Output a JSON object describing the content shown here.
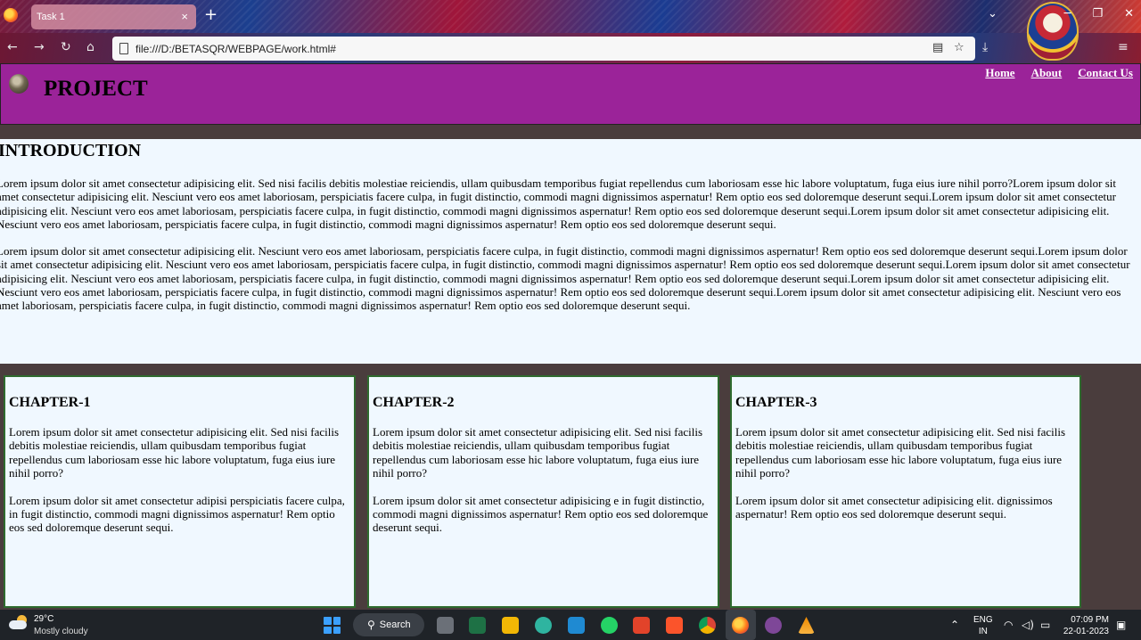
{
  "browser": {
    "tab_title": "Task 1",
    "tab_close": "×",
    "new_tab": "+",
    "url": "file:///D:/BETASQR/WEBPAGE/work.html#",
    "icons": [
      "firefox-icon",
      "back-icon",
      "forward-icon",
      "reload-icon",
      "home-icon",
      "reader-view-icon",
      "bookmark-star-icon",
      "download-icon",
      "menu-icon"
    ]
  },
  "site": {
    "title": "PROJECT",
    "nav": [
      "Home",
      "About",
      "Contact Us"
    ],
    "colors": {
      "header": "#9b2399",
      "content": "#f0f8ff",
      "background": "#4a3d3d",
      "chapter_border": "#2e6b2e"
    }
  },
  "intro": {
    "heading": "INTRODUCTION",
    "p1": "Lorem ipsum dolor sit amet consectetur adipisicing elit. Sed nisi facilis debitis molestiae reiciendis, ullam quibusdam temporibus fugiat repellendus cum laboriosam esse hic labore voluptatum, fuga eius iure nihil porro?Lorem ipsum dolor sit amet consectetur adipisicing elit. Nesciunt vero eos amet laboriosam, perspiciatis facere culpa, in fugit distinctio, commodi magni dignissimos aspernatur! Rem optio eos sed doloremque deserunt sequi.Lorem ipsum dolor sit amet consectetur adipisicing elit. Nesciunt vero eos amet laboriosam, perspiciatis facere culpa, in fugit distinctio, commodi magni dignissimos aspernatur! Rem optio eos sed doloremque deserunt sequi.Lorem ipsum dolor sit amet consectetur adipisicing elit. Nesciunt vero eos amet laboriosam, perspiciatis facere culpa, in fugit distinctio, commodi magni dignissimos aspernatur! Rem optio eos sed doloremque deserunt sequi.",
    "p2": "Lorem ipsum dolor sit amet consectetur adipisicing elit. Nesciunt vero eos amet laboriosam, perspiciatis facere culpa, in fugit distinctio, commodi magni dignissimos aspernatur! Rem optio eos sed doloremque deserunt sequi.Lorem ipsum dolor sit amet consectetur adipisicing elit. Nesciunt vero eos amet laboriosam, perspiciatis facere culpa, in fugit distinctio, commodi magni dignissimos aspernatur! Rem optio eos sed doloremque deserunt sequi.Lorem ipsum dolor sit amet consectetur adipisicing elit. Nesciunt vero eos amet laboriosam, perspiciatis facere culpa, in fugit distinctio, commodi magni dignissimos aspernatur! Rem optio eos sed doloremque deserunt sequi.Lorem ipsum dolor sit amet consectetur adipisicing elit. Nesciunt vero eos amet laboriosam, perspiciatis facere culpa, in fugit distinctio, commodi magni dignissimos aspernatur! Rem optio eos sed doloremque deserunt sequi.Lorem ipsum dolor sit amet consectetur adipisicing elit. Nesciunt vero eos amet laboriosam, perspiciatis facere culpa, in fugit distinctio, commodi magni dignissimos aspernatur! Rem optio eos sed doloremque deserunt sequi."
  },
  "chapters": [
    {
      "heading": "CHAPTER-1",
      "p1": "Lorem ipsum dolor sit amet consectetur adipisicing elit. Sed nisi facilis debitis molestiae reiciendis, ullam quibusdam temporibus fugiat repellendus cum laboriosam esse hic labore voluptatum, fuga eius iure nihil porro?",
      "p2": "Lorem ipsum dolor sit amet consectetur adipisi perspiciatis facere culpa, in fugit distinctio, commodi magni dignissimos aspernatur! Rem optio eos sed doloremque deserunt sequi."
    },
    {
      "heading": "CHAPTER-2",
      "p1": "Lorem ipsum dolor sit amet consectetur adipisicing elit. Sed nisi facilis debitis molestiae reiciendis, ullam quibusdam temporibus fugiat repellendus cum laboriosam esse hic labore voluptatum, fuga eius iure nihil porro?",
      "p2": "Lorem ipsum dolor sit amet consectetur adipisicing e in fugit distinctio, commodi magni dignissimos aspernatur! Rem optio eos sed doloremque deserunt sequi."
    },
    {
      "heading": "CHAPTER-3",
      "p1": "Lorem ipsum dolor sit amet consectetur adipisicing elit. Sed nisi facilis debitis molestiae reiciendis, ullam quibusdam temporibus fugiat repellendus cum laboriosam esse hic labore voluptatum, fuga eius iure nihil porro?",
      "p2": "Lorem ipsum dolor sit amet consectetur adipisicing elit. dignissimos aspernatur! Rem optio eos sed doloremque deserunt sequi."
    }
  ],
  "taskbar": {
    "temperature": "29°C",
    "condition": "Mostly cloudy",
    "search_label": "Search",
    "lang_line1": "ENG",
    "lang_line2": "IN",
    "time": "07:09 PM",
    "date": "22-01-2023",
    "apps": [
      "task-view",
      "excel",
      "file-explorer",
      "edge",
      "vscode",
      "whatsapp",
      "office",
      "brave",
      "chrome",
      "firefox",
      "tor-browser",
      "vlc"
    ]
  }
}
